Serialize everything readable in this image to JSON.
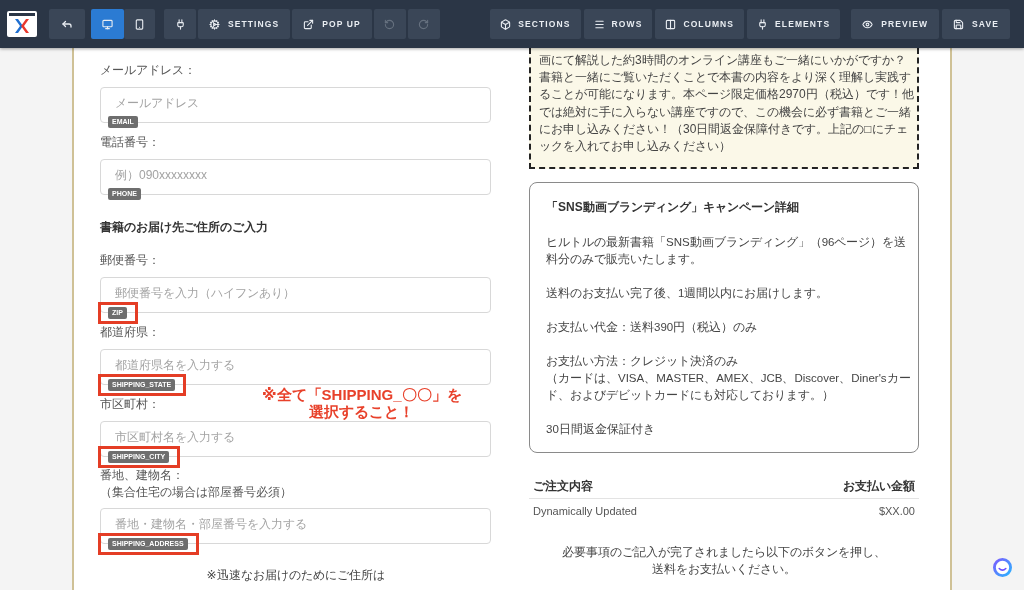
{
  "toolbar": {
    "view_buttons": [
      {
        "selected": true
      },
      {
        "selected": false
      }
    ],
    "edit_buttons": [
      {
        "disabled": false
      },
      {
        "label": "SETTINGS",
        "disabled": false
      },
      {
        "label": "POP UP",
        "disabled": false
      },
      {
        "disabled": true
      },
      {
        "disabled": true
      }
    ],
    "structure_buttons": [
      {
        "label": "SECTIONS"
      },
      {
        "label": "ROWS"
      },
      {
        "label": "COLUMNS"
      },
      {
        "label": "ELEMENTS"
      }
    ],
    "action_buttons": [
      {
        "label": "PREVIEW"
      },
      {
        "label": "SAVE"
      }
    ]
  },
  "form": {
    "items": [
      {
        "kind": "field",
        "label": "メールアドレス：",
        "placeholder": "メールアドレス",
        "tag": "EMAIL",
        "highlighted": false
      },
      {
        "kind": "field",
        "label": "電話番号：",
        "placeholder": "例）090xxxxxxxx",
        "tag": "PHONE",
        "highlighted": false
      },
      {
        "kind": "heading",
        "text": "書籍のお届け先ご住所のご入力"
      },
      {
        "kind": "field",
        "label": "郵便番号：",
        "placeholder": "郵便番号を入力（ハイフンあり）",
        "tag": "ZIP",
        "highlighted": true
      },
      {
        "kind": "field",
        "label": "都道府県：",
        "placeholder": "都道府県名を入力する",
        "tag": "SHIPPING_STATE",
        "highlighted": true
      },
      {
        "kind": "field",
        "label": "市区町村：",
        "placeholder": "市区町村名を入力する",
        "tag": "SHIPPING_CITY",
        "highlighted": true
      },
      {
        "kind": "field",
        "label": "番地、建物名：",
        "note": "（集合住宅の場合は部屋番号必須）",
        "placeholder": "番地・建物名・部屋番号を入力する",
        "tag": "SHIPPING_ADDRESS",
        "highlighted": true
      }
    ],
    "annotation": {
      "lines": [
        "※全て「SHIPPING_〇〇」を",
        "選択すること！"
      ]
    },
    "footnote": "※迅速なお届けのためにご住所は"
  },
  "offer_box": {
    "lines": [
      "画にて解説した約3時間のオンライン講座もご一緒にいかがですか？",
      "書籍と一緒にご覧いただくことで本書の内容をより深く理解し実践す",
      "ることが可能になります。本ページ限定価格2970円（税込）です！他",
      "では絶対に手に入らない講座ですので、この機会に必ず書籍とご一緒",
      "にお申し込みください！（30日間返金保障付きです。上記の□にチェ",
      "ックを入れてお申し込みください）"
    ]
  },
  "campaign_details": {
    "title": "「SNS動画ブランディング」キャンペーン詳細",
    "paragraphs": [
      {
        "lines": [
          "ヒルトルの最新書籍「SNS動画ブランディング」（96ページ）を送",
          "料分のみで販売いたします。"
        ]
      },
      {
        "lines": [
          "送料のお支払い完了後、1週間以内にお届けします。"
        ]
      },
      {
        "lines": [
          "お支払い代金：送料390円（税込）のみ"
        ]
      },
      {
        "lines": [
          "お支払い方法：クレジット決済のみ",
          "（カードは、VISA、MASTER、AMEX、JCB、Discover、Diner'sカー",
          "ド、およびデビットカードにも対応しております。）"
        ]
      },
      {
        "lines": [
          "30日間返金保証付き"
        ]
      }
    ]
  },
  "order_summary": {
    "columns": [
      "ご注文内容",
      "お支払い金額"
    ],
    "rows": [
      [
        "Dynamically Updated",
        "$XX.00"
      ]
    ]
  },
  "instructions": {
    "lines": [
      "必要事項のご記入が完了されましたら以下のボタンを押し、",
      "送料をお支払いください。"
    ]
  }
}
